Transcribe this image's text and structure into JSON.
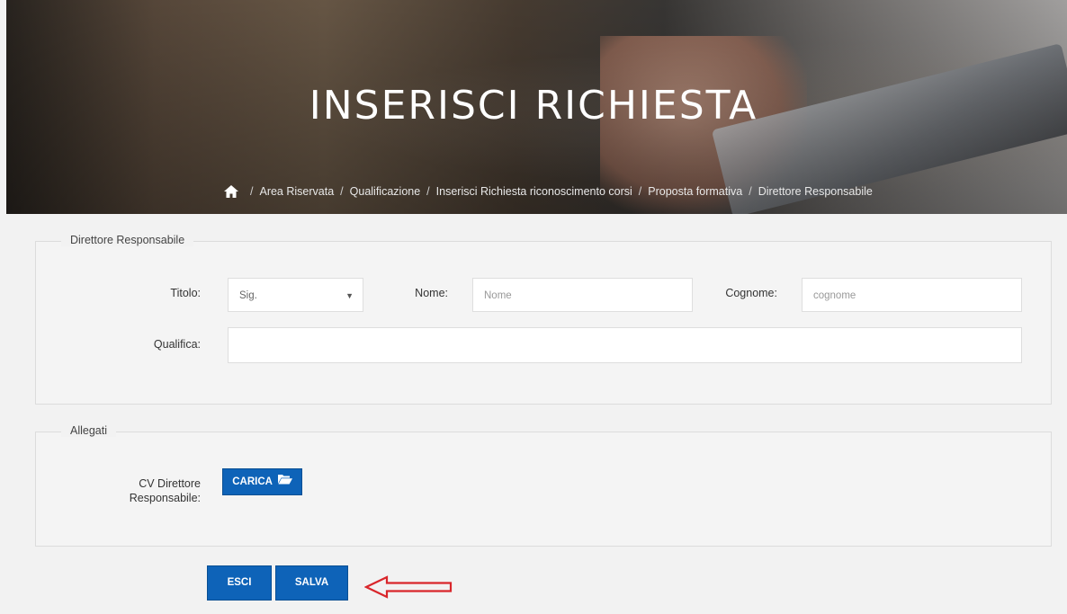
{
  "hero": {
    "title": "INSERISCI RICHIESTA"
  },
  "breadcrumb": {
    "separator": "/",
    "items": [
      "Area Riservata",
      "Qualificazione",
      "Inserisci Richiesta riconoscimento corsi",
      "Proposta formativa",
      "Direttore Responsabile"
    ]
  },
  "direttore": {
    "legend": "Direttore Responsabile",
    "titolo_label": "Titolo:",
    "titolo_value": "Sig.",
    "nome_label": "Nome:",
    "nome_placeholder": "Nome",
    "cognome_label": "Cognome:",
    "cognome_placeholder": "cognome",
    "qualifica_label": "Qualifica:",
    "qualifica_value": ""
  },
  "allegati": {
    "legend": "Allegati",
    "cv_label_line1": "CV Direttore",
    "cv_label_line2": "Responsabile:",
    "carica_label": "CARICA"
  },
  "actions": {
    "esci_label": "ESCI",
    "salva_label": "SALVA"
  },
  "colors": {
    "primary_button": "#0e63b8",
    "annotation_arrow": "#d9262b"
  },
  "icons": {
    "home": "home-icon",
    "folder": "folder-open-icon",
    "caret": "caret-down-icon",
    "annotation": "arrow-left-annotation"
  }
}
